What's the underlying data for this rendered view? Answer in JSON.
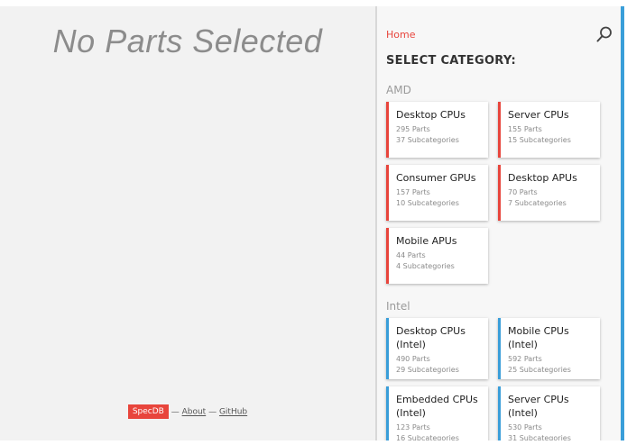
{
  "left": {
    "heading": "No Parts Selected",
    "footer": {
      "brand": "SpecDB",
      "sep1": "—",
      "about": "About",
      "sep2": "—",
      "github": "GitHub"
    }
  },
  "right": {
    "breadcrumb": "Home",
    "section_title": "SELECT CATEGORY:",
    "groups": [
      {
        "label": "AMD",
        "accent": "#e8453c",
        "cards": [
          {
            "name": "Desktop CPUs",
            "parts": "295 Parts",
            "subcats": "37 Subcategories"
          },
          {
            "name": "Server CPUs",
            "parts": "155 Parts",
            "subcats": "15 Subcategories"
          },
          {
            "name": "Consumer GPUs",
            "parts": "157 Parts",
            "subcats": "10 Subcategories"
          },
          {
            "name": "Desktop APUs",
            "parts": "70 Parts",
            "subcats": "7 Subcategories"
          },
          {
            "name": "Mobile APUs",
            "parts": "44 Parts",
            "subcats": "4 Subcategories"
          }
        ]
      },
      {
        "label": "Intel",
        "accent": "#3a9ed9",
        "cards": [
          {
            "name": "Desktop CPUs (Intel)",
            "parts": "490 Parts",
            "subcats": "29 Subcategories"
          },
          {
            "name": "Mobile CPUs (Intel)",
            "parts": "592 Parts",
            "subcats": "25 Subcategories"
          },
          {
            "name": "Embedded CPUs (Intel)",
            "parts": "123 Parts",
            "subcats": "16 Subcategories"
          },
          {
            "name": "Server CPUs (Intel)",
            "parts": "530 Parts",
            "subcats": "31 Subcategories"
          }
        ]
      }
    ]
  },
  "colors": {
    "brand_red": "#e8453c",
    "intel_blue": "#3a9ed9"
  },
  "icons": {
    "search": "search-icon"
  }
}
